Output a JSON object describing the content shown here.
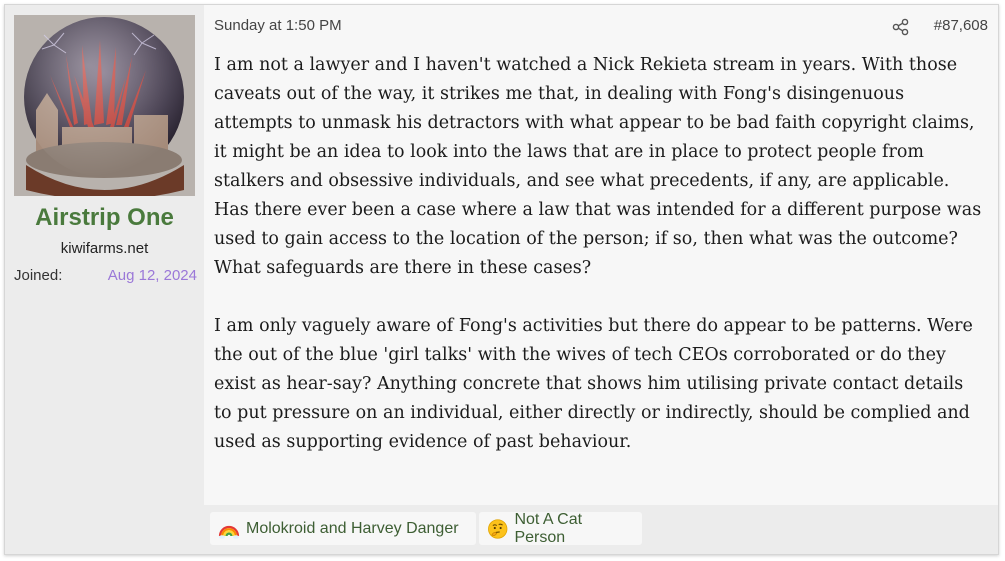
{
  "user": {
    "name": "Airstrip One",
    "site": "kiwifarms.net",
    "joined_label": "Joined:",
    "joined_date": "Aug 12, 2024"
  },
  "post": {
    "date": "Sunday at 1:50 PM",
    "number": "#87,608",
    "paragraphs": [
      "I am not a lawyer and I haven't watched a Nick Rekieta stream in years. With those caveats out of the way, it strikes me that, in dealing with Fong's disingenuous attempts to unmask his detractors with what appear to be bad faith copyright claims, it might be an idea to look into the laws that are in place to protect people from stalkers and obsessive individuals, and see what precedents, if any, are applicable. Has there ever been a case where a law that was intended for a different purpose was used to gain access to the location of the person; if so, then what was the outcome? What safeguards are there in these cases?",
      "I am only vaguely aware of Fong's activities but there do appear to be patterns. Were the out of the blue 'girl talks' with the wives of tech CEOs corroborated or do they exist as hear-say? Anything concrete that shows him utilising private contact details to put pressure on an individual, either directly or indirectly, should be complied and used as supporting evidence of past behaviour."
    ]
  },
  "reactions": [
    {
      "label": "Molokroid and Harvey Danger",
      "icon": "rainbow-icon"
    },
    {
      "label": "Not A Cat Person",
      "icon": "thinking-face-icon"
    }
  ],
  "colors": {
    "username": "#4a7a3d",
    "joined_date": "#9b78d8",
    "reaction_text": "#3d5e33"
  }
}
